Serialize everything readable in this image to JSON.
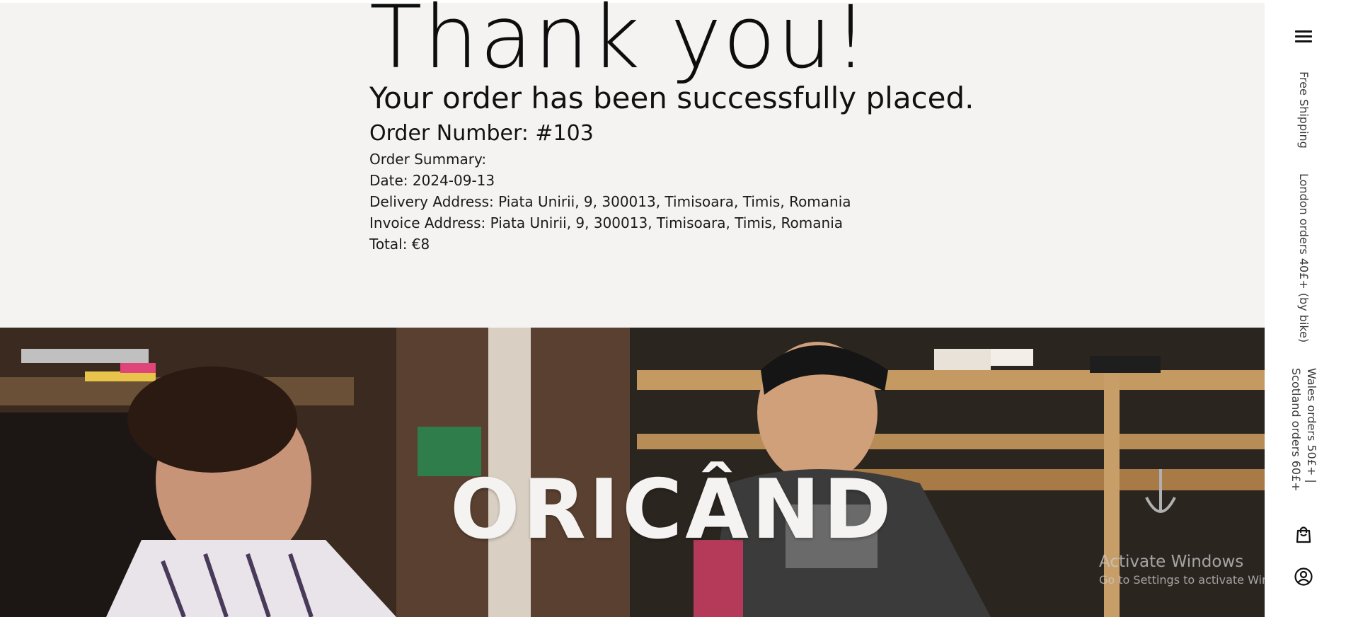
{
  "confirmation": {
    "title": "Thank you!",
    "message": "Your order has been successfully placed.",
    "order_number": "Order Number: #103",
    "summary_label": "Order Summary:",
    "date": "Date: 2024-09-13",
    "delivery_address": "Delivery Address: Piata Unirii, 9, 300013, Timisoara, Timis, Romania",
    "invoice_address": "Invoice Address: Piata Unirii, 9, 300013, Timisoara, Timis, Romania",
    "total": "Total: €8"
  },
  "hero": {
    "word": "ORICÂND",
    "image_alt": "two men smiling in a cafe"
  },
  "sidebar": {
    "menu_icon": "hamburger-menu-icon",
    "shipping_title": "Free Shipping",
    "shipping_london": "London orders 40£+ (by bike)",
    "shipping_wales": "Wales orders 50£+ |",
    "shipping_scotland": "Scotland orders 60£+",
    "cart_icon": "shopping-bag-icon",
    "account_icon": "user-account-icon"
  },
  "watermark": {
    "line1": "Activate Windows",
    "line2": "Go to Settings to activate Windows."
  },
  "colors": {
    "confirmation_bg": "#f5f3f1",
    "text": "#111111",
    "hero_text": "#f5f3f1",
    "sidebar_bg": "#ffffff"
  }
}
